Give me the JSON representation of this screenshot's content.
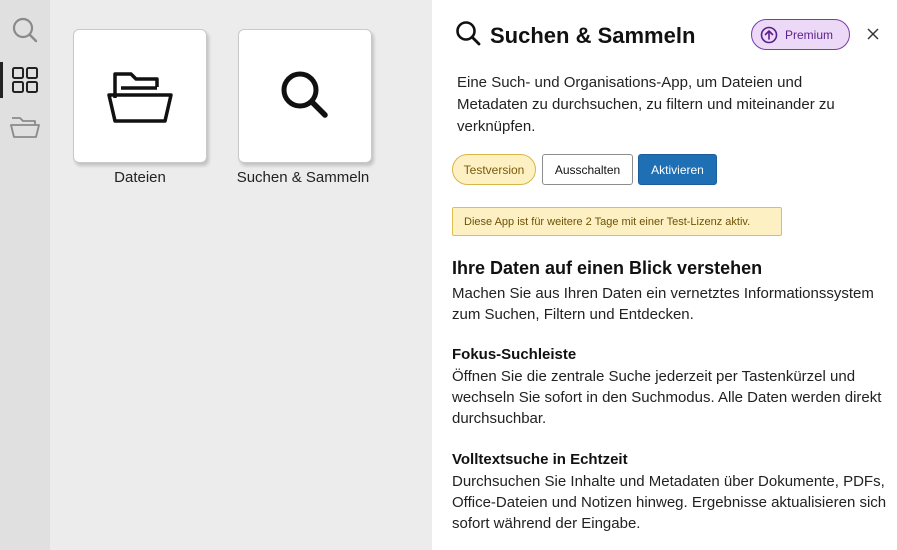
{
  "rail": {
    "items": [
      {
        "name": "search",
        "icon": "search-icon"
      },
      {
        "name": "apps",
        "icon": "grid-icon",
        "active": true
      },
      {
        "name": "files",
        "icon": "folder-icon"
      }
    ]
  },
  "apps": [
    {
      "label": "Dateien",
      "icon": "folder-open-icon"
    },
    {
      "label": "Suchen & Sammeln",
      "icon": "search-icon"
    }
  ],
  "panel": {
    "title": "Suchen & Sammeln",
    "premium_label": "Premium",
    "description": "Eine Such- und Organisations-App, um Dateien und Metadaten zu durchsuchen, zu filtern und miteinander zu verknüpfen.",
    "buttons": {
      "trial": "Testversion",
      "disable": "Ausschalten",
      "activate": "Aktivieren"
    },
    "notice": "Diese App ist für weitere 2 Tage mit einer Test-Lizenz aktiv.",
    "heading": "Ihre Daten auf einen Blick verstehen",
    "intro": "Machen Sie aus Ihren Daten ein vernetztes Informationssystem zum Suchen, Filtern und Entdecken.",
    "features": [
      {
        "title": "Fokus-Suchleiste",
        "text": "Öffnen Sie die zentrale Suche jederzeit per Tastenkürzel und wechseln Sie sofort in den Suchmodus. Alle Daten werden direkt durchsuchbar."
      },
      {
        "title": "Volltextsuche in Echtzeit",
        "text": "Durchsuchen Sie Inhalte und Metadaten über Dokumente, PDFs, Office-Dateien und Notizen hinweg. Ergebnisse aktualisieren sich sofort während der Eingabe."
      }
    ]
  },
  "colors": {
    "accent": "#1f6fb5",
    "premium": "#7a3bb0",
    "trial": "#fdf1c4"
  }
}
